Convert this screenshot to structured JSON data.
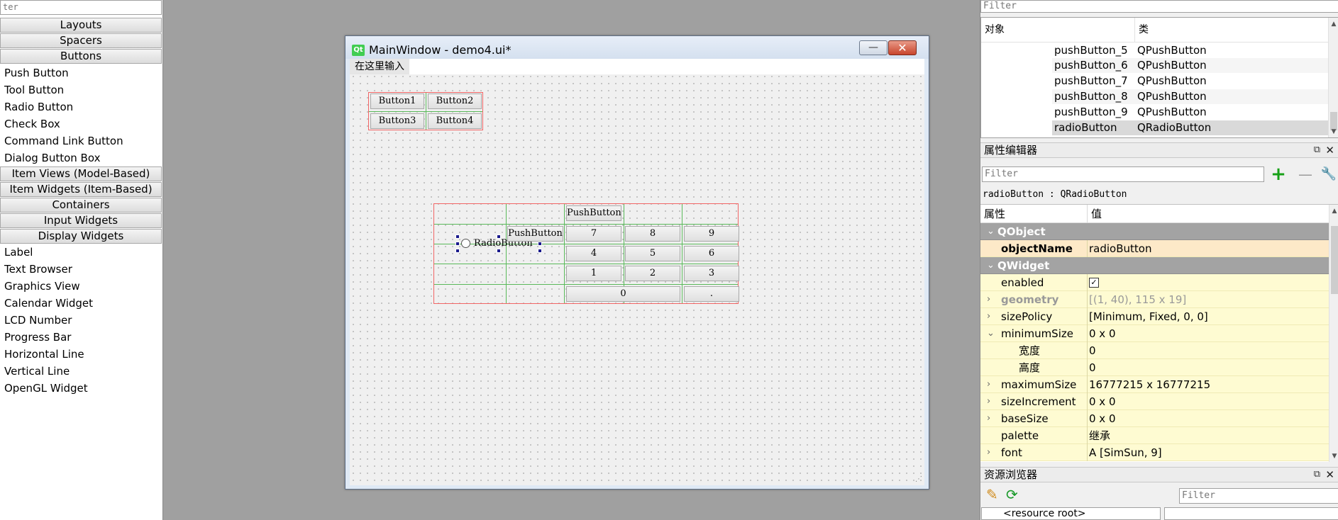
{
  "widget_box": {
    "filter_placeholder": "ter",
    "categories": [
      "Layouts",
      "Spacers",
      "Buttons",
      "Item Views (Model-Based)",
      "Item Widgets (Item-Based)",
      "Containers",
      "Input Widgets",
      "Display Widgets"
    ],
    "buttons_items": [
      "Push Button",
      "Tool Button",
      "Radio Button",
      "Check Box",
      "Command Link Button",
      "Dialog Button Box"
    ],
    "display_items": [
      "Label",
      "Text Browser",
      "Graphics View",
      "Calendar Widget",
      "LCD Number",
      "Progress Bar",
      "Horizontal Line",
      "Vertical Line",
      "OpenGL Widget"
    ]
  },
  "form": {
    "logo": "Qt",
    "title": "MainWindow - demo4.ui*",
    "minimize_symbol": "—",
    "close_symbol": "✕",
    "menu_placeholder": "在这里输入",
    "grid1": [
      "Button1",
      "Button2",
      "Button3",
      "Button4"
    ],
    "grid2": {
      "top_button": "PushButton",
      "radio_label": "RadioButton",
      "row2_button": "PushButton",
      "keys": [
        "7",
        "8",
        "9",
        "4",
        "5",
        "6",
        "1",
        "2",
        "3",
        "0",
        "."
      ]
    }
  },
  "object_inspector": {
    "filter_placeholder": "Filter",
    "col_object": "对象",
    "col_class": "类",
    "rows": [
      {
        "name": "pushButton_5",
        "cls": "QPushButton"
      },
      {
        "name": "pushButton_6",
        "cls": "QPushButton"
      },
      {
        "name": "pushButton_7",
        "cls": "QPushButton"
      },
      {
        "name": "pushButton_8",
        "cls": "QPushButton"
      },
      {
        "name": "pushButton_9",
        "cls": "QPushButton"
      },
      {
        "name": "radioButton",
        "cls": "QRadioButton"
      }
    ]
  },
  "property_editor": {
    "title": "属性编辑器",
    "filter_placeholder": "Filter",
    "object_label": "radioButton : QRadioButton",
    "col_property": "属性",
    "col_value": "值",
    "rows": [
      {
        "name": "QObject",
        "value": ""
      },
      {
        "name": "objectName",
        "value": "radioButton"
      },
      {
        "name": "QWidget",
        "value": ""
      },
      {
        "name": "enabled",
        "value": "✓"
      },
      {
        "name": "geometry",
        "value": "[(1, 40), 115 x 19]"
      },
      {
        "name": "sizePolicy",
        "value": "[Minimum, Fixed, 0, 0]"
      },
      {
        "name": "minimumSize",
        "value": "0 x 0"
      },
      {
        "name": "宽度",
        "value": "0"
      },
      {
        "name": "高度",
        "value": "0"
      },
      {
        "name": "maximumSize",
        "value": "16777215 x 16777215"
      },
      {
        "name": "sizeIncrement",
        "value": "0 x 0"
      },
      {
        "name": "baseSize",
        "value": "0 x 0"
      },
      {
        "name": "palette",
        "value": "继承"
      },
      {
        "name": "font",
        "value": "A  [SimSun, 9]"
      }
    ]
  },
  "resource_browser": {
    "title": "资源浏览器",
    "filter_placeholder": "Filter",
    "root": "<resource root>"
  },
  "colors": {
    "layout_outline": "#f26565",
    "layout_gridline": "#5ab95a",
    "property_row": "#fefbd2",
    "property_group": "#a3a3a3",
    "selection": "#d9d9d9"
  }
}
